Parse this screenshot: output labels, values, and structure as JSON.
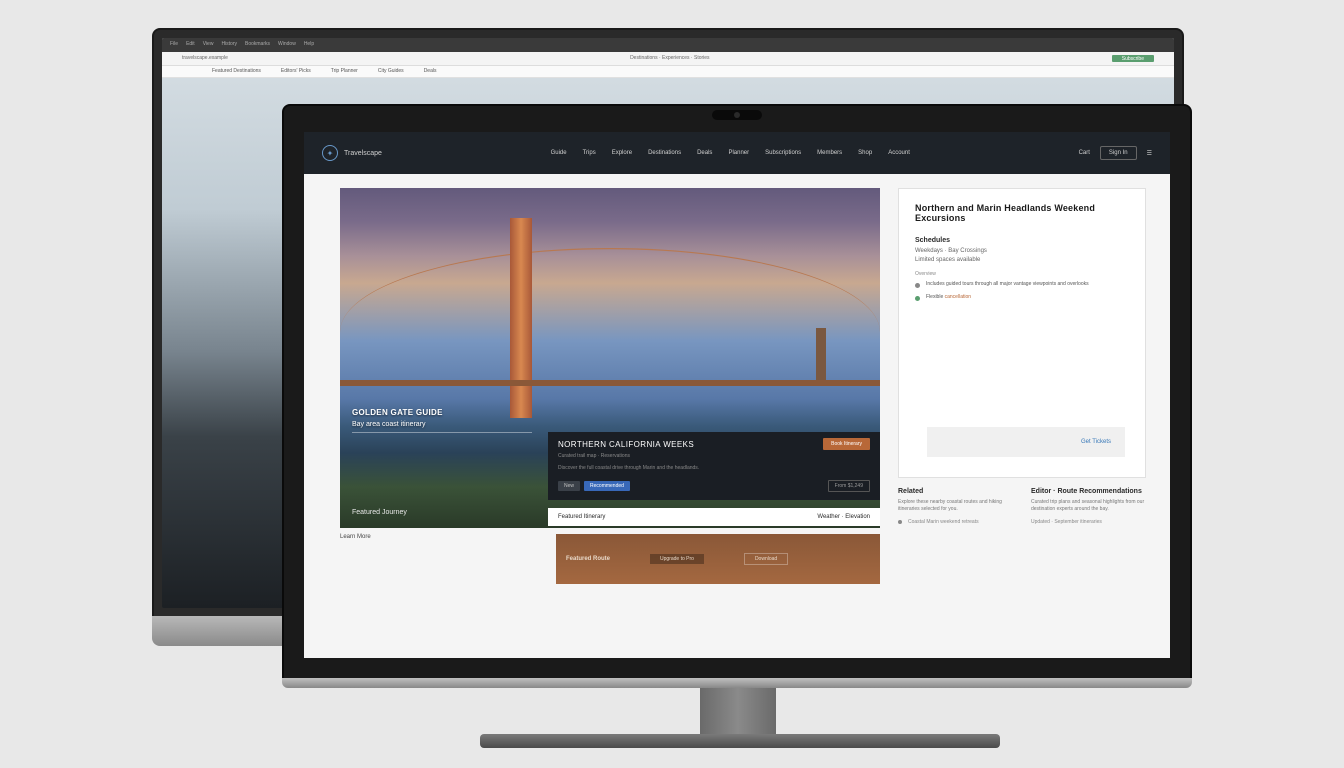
{
  "back_browser": {
    "chrome_items": [
      "File",
      "Edit",
      "View",
      "History",
      "Bookmarks",
      "Window",
      "Help"
    ],
    "toolbar_left": "travelscape.example",
    "toolbar_mid": "Destinations · Experiences · Stories",
    "toolbar_cta": "Subscribe",
    "subnav": [
      "Featured Destinations",
      "Editors' Picks",
      "Trip Planner",
      "City Guides",
      "Deals"
    ]
  },
  "site": {
    "brand": "Travelscape",
    "nav": [
      "Guide",
      "Trips",
      "Explore",
      "Destinations",
      "Deals",
      "Planner",
      "Subscriptions",
      "Members",
      "Shop",
      "Account"
    ],
    "nav_btn": "Sign In",
    "cart_label": "Cart"
  },
  "hero": {
    "line1": "GOLDEN GATE GUIDE",
    "line2": "Bay area coast itinerary",
    "bottom_left1": "Featured Journey",
    "bottom_left2": "Learn More"
  },
  "dark_card": {
    "title": "NORTHERN CALIFORNIA WEEKS",
    "subtitle": "Curated trail map · Reservations",
    "desc": "Discover the full coastal drive through Marin and the headlands.",
    "cta": "Book Itinerary",
    "tag1": "New",
    "tag2": "Recommended",
    "tag_right": "From $1,249"
  },
  "below": {
    "left": "Featured Itinerary",
    "right": "Weather · Elevation"
  },
  "brown": {
    "label": "Featured Route",
    "btn1": "Upgrade to Pro",
    "btn2": "Download"
  },
  "main_bottom": {
    "left_label": "Learn More"
  },
  "sidebar": {
    "title": "Northern and Marin Headlands Weekend Excursions",
    "section": "Schedules",
    "line1": "Weekdays · Bay Crossings",
    "line2": "Limited spaces available",
    "small": "Overview",
    "bullet1": "Includes guided tours through all major vantage viewpoints and overlooks",
    "bullet2_a": "Flexible ",
    "bullet2_b": "cancellation",
    "cta": "Get Tickets"
  },
  "lower": {
    "left_h": "Related",
    "left_p": "Explore these nearby coastal routes and hiking itineraries selected for you.",
    "left_meta1": "Coastal Marin weekend retreats",
    "right_h": "Editor · Route Recommendations",
    "right_p": "Curated trip plans and seasonal highlights from our destination experts around the bay.",
    "right_meta": "Updated · September itineraries"
  }
}
